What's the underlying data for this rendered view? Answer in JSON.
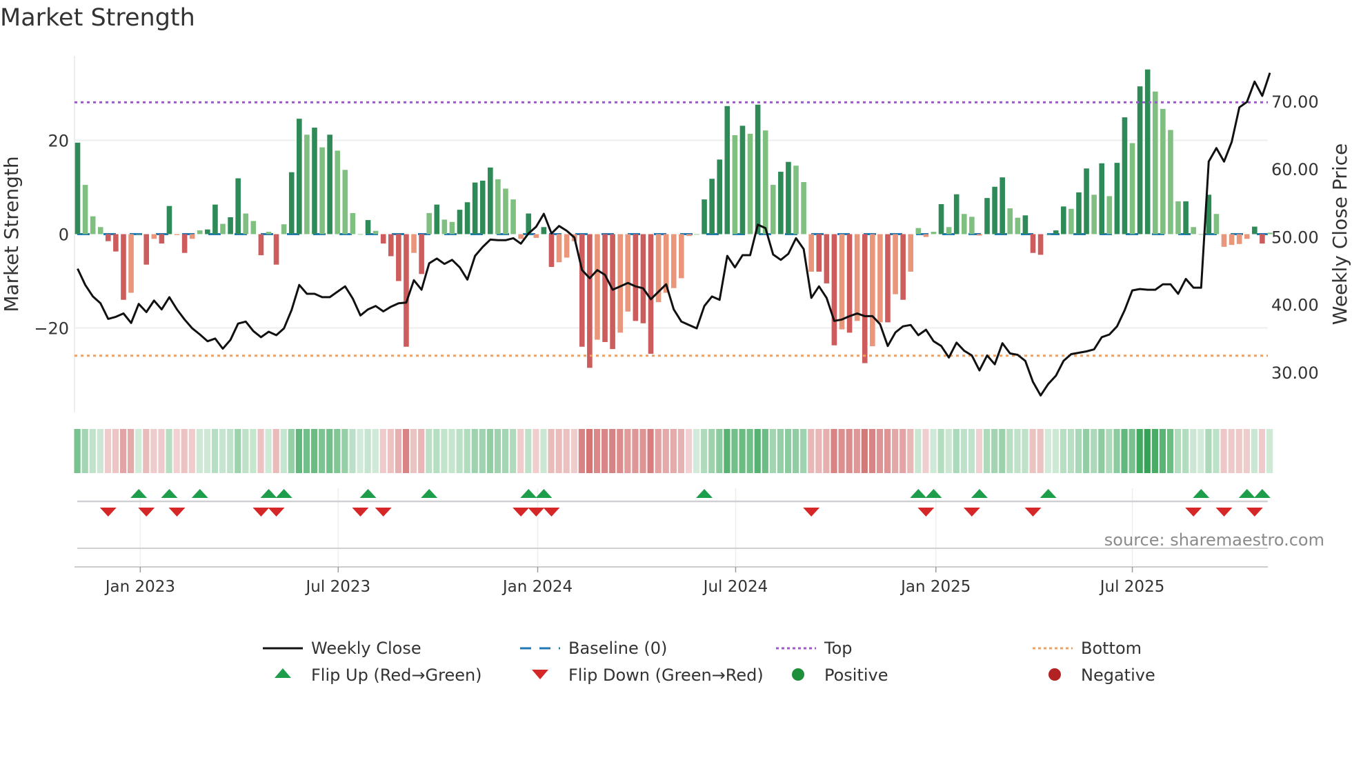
{
  "title": "Market Strength",
  "source": "source: sharemaestro.com",
  "colors": {
    "strong_green": "#2e8b57",
    "light_green": "#7fbf7f",
    "strong_red": "#cd5c5c",
    "light_red": "#e9967a",
    "baseline": "#1f77b4",
    "top": "#9b59d0",
    "bottom": "#f0a060",
    "flip_up": "#1e9e4a",
    "flip_down": "#d62728",
    "positive": "#1e8f3a",
    "negative": "#b22222",
    "close": "#111111"
  },
  "legend": [
    {
      "label": "Weekly Close",
      "kind": "line"
    },
    {
      "label": "Baseline (0)",
      "kind": "baseline"
    },
    {
      "label": "Top",
      "kind": "top"
    },
    {
      "label": "Bottom",
      "kind": "bottom"
    },
    {
      "label": "Flip Up (Red→Green)",
      "kind": "up"
    },
    {
      "label": "Flip Down (Green→Red)",
      "kind": "down"
    },
    {
      "label": "Positive",
      "kind": "pos"
    },
    {
      "label": "Negative",
      "kind": "neg"
    }
  ],
  "chart_data": {
    "type": "bar",
    "title": "Market Strength",
    "ylabel": "Market Strength",
    "y2label": "Weekly Close Price",
    "ylim": [
      -38,
      38
    ],
    "y2lim": [
      24.1,
      76.7
    ],
    "yticks": [
      {
        "v": 20,
        "label": "20"
      },
      {
        "v": 0,
        "label": "0"
      },
      {
        "v": -20,
        "label": "−20"
      }
    ],
    "y2ticks": [
      {
        "v": 70,
        "label": "70.00"
      },
      {
        "v": 60,
        "label": "60.00"
      },
      {
        "v": 50,
        "label": "50.00"
      },
      {
        "v": 40,
        "label": "40.00"
      },
      {
        "v": 30,
        "label": "30.00"
      }
    ],
    "xticks": [
      {
        "week": 8.2,
        "label": "Jan 2023"
      },
      {
        "week": 34.1,
        "label": "Jul 2023"
      },
      {
        "week": 60.2,
        "label": "Jan 2024"
      },
      {
        "week": 86.1,
        "label": "Jul 2024"
      },
      {
        "week": 112.3,
        "label": "Jan 2025"
      },
      {
        "week": 138.0,
        "label": "Jul 2025"
      }
    ],
    "x_unit": "week index (weekly, Nov 2022 – Oct 2025)",
    "top_level": 28.1,
    "bottom_level": -25.9,
    "strength": [
      19.5,
      10.5,
      3.8,
      1.5,
      -1.5,
      -3.7,
      -14,
      -12.5,
      0,
      -6.5,
      -1,
      -2,
      6,
      -0.2,
      -4,
      -1,
      0.8,
      1,
      6.3,
      2.2,
      3.6,
      11.9,
      4.4,
      2.8,
      -4.5,
      0.5,
      -6.5,
      2.1,
      13.2,
      24.6,
      21.2,
      22.7,
      18.5,
      21.2,
      17.8,
      13.7,
      4.5,
      0,
      3,
      0.7,
      -2,
      -4.7,
      -10,
      -24,
      -4,
      -8.5,
      4.5,
      6.3,
      3.1,
      2.6,
      5.2,
      6.8,
      11,
      11.4,
      14.2,
      11.7,
      9.7,
      7.4,
      -1,
      4.4,
      -0.8,
      1.5,
      -7,
      -6,
      -5,
      -1.5,
      -24,
      -28.5,
      -22.5,
      -23,
      -24.5,
      -21,
      -16.5,
      -18.5,
      -19,
      -25.5,
      -14.5,
      -12.5,
      -11.5,
      -9.4,
      -0.4,
      0,
      7.4,
      11.8,
      15.9,
      27.3,
      21.1,
      23.1,
      21.4,
      27.6,
      22.1,
      10.5,
      13.3,
      15.4,
      14.6,
      11.1,
      -8,
      -8,
      -10.5,
      -23.7,
      -20.3,
      -21,
      -18.5,
      -27.5,
      -23.9,
      -18.8,
      -18.8,
      -12.8,
      -14,
      -8,
      1.3,
      -0.6,
      0.5,
      6.4,
      1.5,
      8.5,
      4.3,
      3.7,
      -0.3,
      7.7,
      10.1,
      12.1,
      5.5,
      3.5,
      4,
      -4,
      -4.4,
      0,
      0.8,
      5.9,
      5.4,
      8.9,
      14,
      8.4,
      15.1,
      8.1,
      15.2,
      24.9,
      19.4,
      31.5,
      35.1,
      30.4,
      26.7,
      22.2,
      7,
      7,
      1.5,
      0,
      8.4,
      4.3,
      -2.7,
      -2.3,
      -2.1,
      -1,
      1.6,
      -2,
      0.3
    ],
    "weekly_close": [
      45.3,
      42.9,
      41.2,
      40.2,
      37.9,
      38.2,
      38.7,
      37.3,
      40.1,
      38.9,
      40.6,
      39.3,
      41.1,
      39.3,
      37.8,
      36.5,
      35.6,
      34.6,
      35,
      33.5,
      34.8,
      37.2,
      37.5,
      36.1,
      35.2,
      36,
      35.5,
      36.5,
      39.2,
      42.9,
      41.6,
      41.6,
      41.1,
      41.1,
      41.9,
      42.7,
      40.9,
      38.4,
      39.3,
      39.8,
      39,
      39.7,
      40.2,
      40.3,
      43.6,
      42.2,
      46.1,
      46.8,
      46,
      46.6,
      45.5,
      43.7,
      47.2,
      48.5,
      49.6,
      49.5,
      49.5,
      49.8,
      49,
      50.5,
      51.5,
      53.4,
      50.5,
      51.6,
      50.9,
      49.9,
      45.1,
      43.9,
      45.1,
      44.4,
      42.2,
      42.7,
      43.2,
      42.7,
      42.4,
      40.8,
      41.9,
      43,
      39.3,
      37.5,
      37,
      36.5,
      39.8,
      41.2,
      40.7,
      47.2,
      45.5,
      47.3,
      47.3,
      51.8,
      51.3,
      47.4,
      46.6,
      47.5,
      49.8,
      48.2,
      41,
      42.7,
      41,
      37.6,
      37.8,
      38.3,
      38.7,
      38.3,
      38.3,
      37.1,
      33.9,
      35.9,
      36.8,
      37,
      35.5,
      36.3,
      34.6,
      33.9,
      32.2,
      34.4,
      33.2,
      32.5,
      30.3,
      32.5,
      31.2,
      34.3,
      32.8,
      32.6,
      31.7,
      28.6,
      26.6,
      28.3,
      29.5,
      31.7,
      32.7,
      32.9,
      33.1,
      33.4,
      35.2,
      35.6,
      36.8,
      39.2,
      42.1,
      42.3,
      42.2,
      42.2,
      43,
      43,
      41.6,
      43.8,
      42.5,
      42.5,
      61.1,
      63.1,
      61.1,
      64,
      69.1,
      69.9,
      72.9,
      70.8,
      74.2
    ],
    "flip_up_weeks": [
      8,
      12,
      16,
      25,
      27,
      38,
      46,
      59,
      61,
      82,
      110,
      112,
      118,
      127,
      147,
      153,
      155
    ],
    "flip_down_weeks": [
      4,
      9,
      13,
      24,
      26,
      37,
      40,
      58,
      60,
      62,
      96,
      111,
      117,
      125,
      146,
      150,
      154
    ],
    "legend_position": "bottom"
  }
}
